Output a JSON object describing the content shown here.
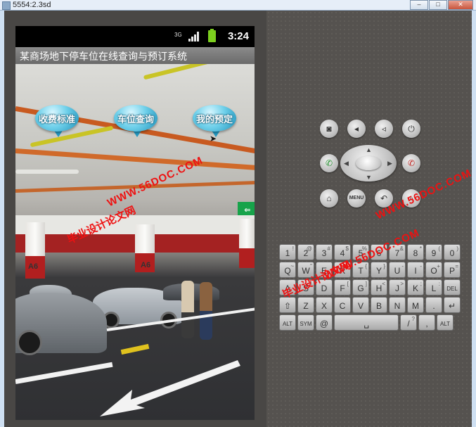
{
  "window": {
    "title": "5554:2.3sd",
    "buttons": [
      "–",
      "□",
      "✕"
    ]
  },
  "phone": {
    "status": {
      "network": "3G",
      "time": "3:24"
    },
    "app_title": "某商场地下停车位在线查询与预订系统",
    "menu_bubbles": [
      {
        "label": "收费标准"
      },
      {
        "label": "车位查询"
      },
      {
        "label": "我的预定"
      }
    ],
    "scene": {
      "pillar_labels": [
        "A6",
        "A6"
      ],
      "exit_sign": "⇐"
    }
  },
  "watermarks": {
    "site": "WWW.56DOC.COM",
    "cn": "毕业设计论文网"
  },
  "controls": {
    "top_row": [
      "camera-icon",
      "volume-down-icon",
      "volume-up-icon",
      "power-icon"
    ],
    "call": "call-icon",
    "end": "end-call-icon",
    "bottom_row": [
      "home-icon",
      "menu-button",
      "back-icon",
      "search-icon"
    ],
    "menu_label": "MENU"
  },
  "keyboard": {
    "row1": [
      {
        "k": "1",
        "s": "!"
      },
      {
        "k": "2",
        "s": "@"
      },
      {
        "k": "3",
        "s": "#"
      },
      {
        "k": "4",
        "s": "$"
      },
      {
        "k": "5",
        "s": "%"
      },
      {
        "k": "6",
        "s": "^"
      },
      {
        "k": "7",
        "s": "&"
      },
      {
        "k": "8",
        "s": "*"
      },
      {
        "k": "9",
        "s": "("
      },
      {
        "k": "0",
        "s": ")"
      }
    ],
    "row2": [
      {
        "k": "Q",
        "s": "~"
      },
      {
        "k": "W",
        "s": "\""
      },
      {
        "k": "E",
        "s": ""
      },
      {
        "k": "R",
        "s": ""
      },
      {
        "k": "T",
        "s": "{"
      },
      {
        "k": "Y",
        "s": "}"
      },
      {
        "k": "U",
        "s": "-"
      },
      {
        "k": "I",
        "s": "-"
      },
      {
        "k": "O",
        "s": "+"
      },
      {
        "k": "P",
        "s": "="
      }
    ],
    "row3": [
      {
        "k": "A",
        "s": ""
      },
      {
        "k": "S",
        "s": "\\"
      },
      {
        "k": "D",
        "s": ""
      },
      {
        "k": "F",
        "s": "["
      },
      {
        "k": "G",
        "s": "]"
      },
      {
        "k": "H",
        "s": "<"
      },
      {
        "k": "J",
        "s": ">"
      },
      {
        "k": "K",
        "s": ";"
      },
      {
        "k": "L",
        "s": ":"
      },
      {
        "k": "DEL",
        "s": ""
      }
    ],
    "row4": [
      {
        "k": "⇧",
        "s": ""
      },
      {
        "k": "Z",
        "s": ""
      },
      {
        "k": "X",
        "s": ""
      },
      {
        "k": "C",
        "s": ""
      },
      {
        "k": "V",
        "s": ""
      },
      {
        "k": "B",
        "s": ""
      },
      {
        "k": "N",
        "s": ""
      },
      {
        "k": "M",
        "s": ""
      },
      {
        "k": ".",
        "s": ""
      },
      {
        "k": "↵",
        "s": ""
      }
    ],
    "row5": [
      {
        "k": "ALT",
        "s": ""
      },
      {
        "k": "SYM",
        "s": ""
      },
      {
        "k": "@",
        "s": ""
      },
      {
        "k": "␣",
        "s": ""
      },
      {
        "k": "/",
        "s": "?"
      },
      {
        "k": ",",
        "s": ""
      },
      {
        "k": "ALT",
        "s": ""
      }
    ]
  }
}
